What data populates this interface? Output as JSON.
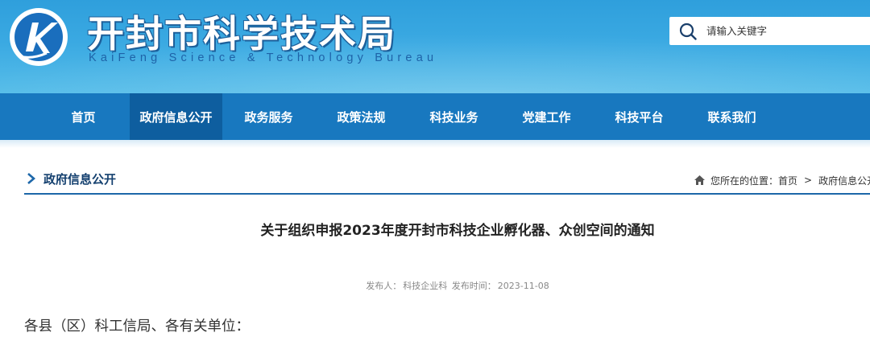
{
  "header": {
    "site_title": "开封市科学技术局",
    "site_subtitle": "KaiFeng Science & Technology Bureau",
    "logo_icon": "kaifeng-k-emblem"
  },
  "search": {
    "placeholder": "请输入关键字",
    "icon": "search-icon"
  },
  "nav": {
    "items": [
      {
        "label": "首页"
      },
      {
        "label": "政府信息公开",
        "active": true
      },
      {
        "label": "政务服务"
      },
      {
        "label": "政策法规"
      },
      {
        "label": "科技业务"
      },
      {
        "label": "党建工作"
      },
      {
        "label": "科技平台"
      },
      {
        "label": "联系我们"
      }
    ]
  },
  "section": {
    "title": "政府信息公开"
  },
  "breadcrumb": {
    "prefix": "您所在的位置：",
    "items": [
      "首页",
      "政府信息公开"
    ],
    "separator": ">"
  },
  "article": {
    "title": "关于组织申报2023年度开封市科技企业孵化器、众创空间的通知",
    "publisher_label": "发布人：",
    "publisher": "科技企业科",
    "time_label": "发布时间：",
    "time": "2023-11-08",
    "salutation": "各县（区）科工信局、各有关单位："
  },
  "colors": {
    "header_top": "#2f9fdc",
    "nav_bg": "#1878bf",
    "nav_active": "#0e5e9f",
    "section_line": "#1d67a9"
  }
}
